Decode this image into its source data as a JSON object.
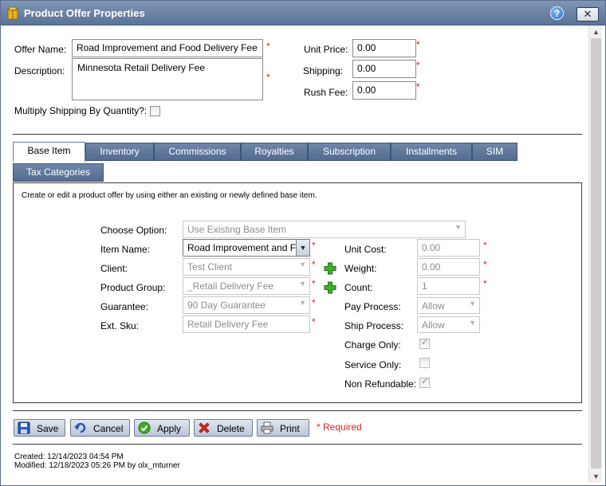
{
  "window": {
    "title": "Product Offer Properties",
    "help_label": "?",
    "close_label": "✕"
  },
  "form": {
    "offer_name_label": "Offer Name:",
    "offer_name_value": "Road Improvement and Food Delivery Fee",
    "description_label": "Description:",
    "description_value": "Minnesota Retail Delivery Fee",
    "multiply_label": "Multiply Shipping By Quantity?:",
    "multiply_checked": false,
    "unit_price_label": "Unit Price:",
    "unit_price_value": "0.00",
    "shipping_label": "Shipping:",
    "shipping_value": "0.00",
    "rush_fee_label": "Rush Fee:",
    "rush_fee_value": "0.00",
    "required_mark": "*"
  },
  "tabs": [
    {
      "label": "Base Item",
      "active": true
    },
    {
      "label": "Inventory"
    },
    {
      "label": "Commissions"
    },
    {
      "label": "Royalties"
    },
    {
      "label": "Subscription"
    },
    {
      "label": "Installments"
    },
    {
      "label": "SIM"
    },
    {
      "label": "Tax Categories"
    }
  ],
  "base_item": {
    "intro": "Create or edit a product offer by using either an existing or newly defined base item.",
    "choose_option_label": "Choose Option:",
    "choose_option_value": "Use Existing Base Item",
    "item_name_label": "Item Name:",
    "item_name_value": "Road Improvement and F",
    "client_label": "Client:",
    "client_value": "Test Client",
    "product_group_label": "Product Group:",
    "product_group_value": "_Retail Delivery Fee",
    "guarantee_label": "Guarantee:",
    "guarantee_value": "90 Day Guarantee",
    "ext_sku_label": "Ext. Sku:",
    "ext_sku_value": "Retail Delivery Fee",
    "unit_cost_label": "Unit Cost:",
    "unit_cost_value": "0.00",
    "weight_label": "Weight:",
    "weight_value": "0.00",
    "count_label": "Count:",
    "count_value": "1",
    "pay_process_label": "Pay Process:",
    "pay_process_value": "Allow",
    "ship_process_label": "Ship Process:",
    "ship_process_value": "Allow",
    "charge_only_label": "Charge Only:",
    "charge_only_checked": true,
    "service_only_label": "Service Only:",
    "service_only_checked": false,
    "non_refundable_label": "Non Refundable:",
    "non_refundable_checked": true
  },
  "buttons": {
    "save": "Save",
    "cancel": "Cancel",
    "apply": "Apply",
    "delete": "Delete",
    "print": "Print",
    "required_note": "* Required"
  },
  "footer": {
    "created": "Created:  12/14/2023 04:54 PM",
    "modified": "Modified: 12/18/2023 05:26 PM  by olx_mturner"
  },
  "colors": {
    "title_bar": "#6a81a3",
    "tab_bg": "#5f779c",
    "required": "#e02020"
  }
}
